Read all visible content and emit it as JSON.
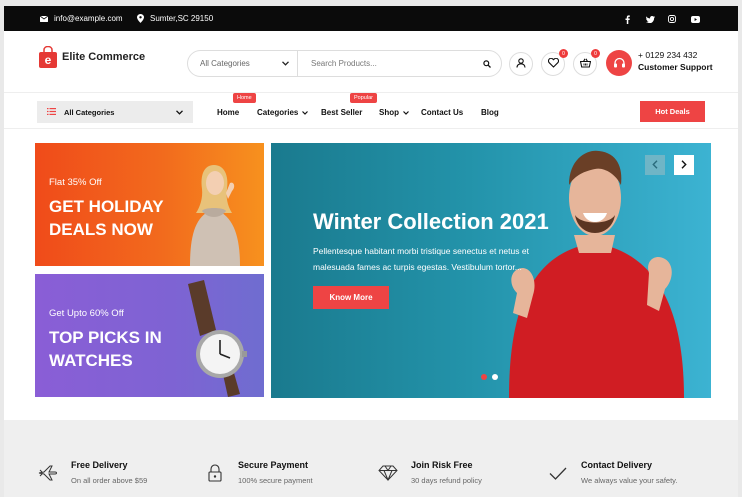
{
  "topbar": {
    "email": "info@example.com",
    "address": "Sumter,SC 29150",
    "social": [
      "facebook-icon",
      "twitter-icon",
      "instagram-icon",
      "youtube-icon"
    ]
  },
  "header": {
    "logo_text": "Elite Commerce",
    "logo_letter": "e",
    "category_select": "All Categories",
    "search_placeholder": "Search Products...",
    "wishlist_count": "0",
    "cart_count": "0",
    "phone": "+ 0129 234 432",
    "support_label": "Customer Support"
  },
  "nav": {
    "all_categories": "All Categories",
    "items": [
      {
        "label": "Home",
        "pill": "Home"
      },
      {
        "label": "Categories"
      },
      {
        "label": "Best Seller",
        "pill": "Popular"
      },
      {
        "label": "Shop"
      },
      {
        "label": "Contact Us"
      },
      {
        "label": "Blog"
      }
    ],
    "hot_deals": "Hot Deals"
  },
  "promos": [
    {
      "small": "Flat 35% Off",
      "big": "GET HOLIDAY DEALS NOW"
    },
    {
      "small": "Get Upto 60% Off",
      "big": "TOP PICKS IN WATCHES"
    }
  ],
  "hero": {
    "title": "Winter Collection 2021",
    "description": "Pellentesque habitant morbi tristique senectus et netus et malesuada fames ac turpis egestas. Vestibulum tortor...",
    "button": "Know More",
    "active_slide": 0,
    "slide_count": 2
  },
  "features": [
    {
      "title": "Free Delivery",
      "subtitle": "On all order above $59",
      "icon": "plane-icon"
    },
    {
      "title": "Secure Payment",
      "subtitle": "100% secure payment",
      "icon": "lock-icon"
    },
    {
      "title": "Join Risk Free",
      "subtitle": "30 days refund policy",
      "icon": "diamond-icon"
    },
    {
      "title": "Contact Delivery",
      "subtitle": "We always value your safety.",
      "icon": "check-icon"
    }
  ],
  "colors": {
    "accent": "#ee4444",
    "topbar": "#0b0b0b",
    "promo_orange": "#f26a1d",
    "promo_purple": "#7e63d3",
    "hero_teal": "#2393aa"
  }
}
